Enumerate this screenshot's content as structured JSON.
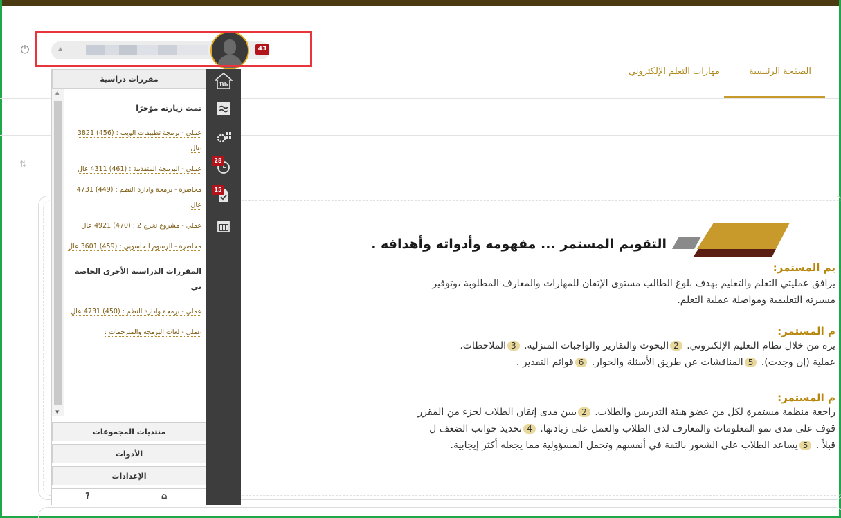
{
  "nav": {
    "home": "الصفحة الرئيسية",
    "skills": "مهارات التعلم الإلكتروني"
  },
  "user": {
    "notification_count": "43"
  },
  "toolbar": {
    "items": [
      {
        "icon": "bb-home-icon"
      },
      {
        "icon": "stream-icon"
      },
      {
        "icon": "grades-icon"
      },
      {
        "icon": "clock-icon",
        "badge": "28"
      },
      {
        "icon": "tasks-icon",
        "badge": "15"
      },
      {
        "icon": "calendar-icon"
      }
    ]
  },
  "drawer": {
    "header": "مقررات دراسية",
    "recent_title": "تمت زيارته مؤخرًا",
    "recent": [
      "عملي - برمجة تطبيقات الويب : (456) 3821 عال",
      "عملي - البرمجة المتقدمة : (461) 4311 عال",
      "محاضرة - برمجة وادارة النظم : (449) 4731 عال",
      "عملي - مشروع تخرج 2 : (470) 4921 عال",
      "محاضرة - الرسوم الحاسوبي : (459) 3601 عال"
    ],
    "other_title": "المقررات الدراسية الأخرى الخاصة بي",
    "other": [
      "عملي - برمجة وادارة النظم : (450) 4731 عال",
      "عملي - لغات البرمجة والمترجمات :"
    ],
    "sections": [
      "منتديات المجموعات",
      "الأدوات",
      "الإعدادات"
    ],
    "footer": {
      "help": "?",
      "home": "⌂"
    }
  },
  "article": {
    "title": "التقويم المستمر ... مفهومه وأدواته وأهدافه .",
    "sec1_head": "يم المستمر:",
    "sec1_lines": [
      "يرافق عمليتي التعلم والتعليم بهدف بلوغ الطالب مستوى الإتقان للمهارات والمعارف المطلوبة ،وتوفير",
      "مسيرته التعليمية ومواصلة عملية التعلم."
    ],
    "sec2_head": "م المستمر:",
    "sec2_line1": [
      "يرة من خلال نظام التعليم الإلكتروني.",
      "2",
      "البحوث والتقارير والواجبات المنزلية.",
      "3",
      "الملاحظات."
    ],
    "sec2_line2": [
      "عملية (إن وجدت).",
      "5",
      "المناقشات عن طريق الأسئلة والحوار.",
      "6",
      "قوائم التقدير ."
    ],
    "sec3_head": "م المستمر:",
    "sec3_line1": [
      "راجعة منظمة مستمرة لكل من عضو هيئة التدريس والطلاب.",
      "2",
      "يبين مدى إتقان الطلاب لجزء من المقرر"
    ],
    "sec3_line2": [
      "قوف على مدى نمو المعلومات والمعارف لدى الطلاب والعمل على زيادتها.",
      "4",
      "تحديد جوانب الضعف ل"
    ],
    "sec3_line3": [
      "قبلاً .",
      "5",
      "يساعد الطلاب على الشعور بالثقة في أنفسهم وتحمل المسؤولية مما يجعله أكثر إيجابية."
    ]
  },
  "colors": {
    "accent": "#c79a2b",
    "badge": "#b3131b",
    "toolbar": "#3d3d3d",
    "frame": "#1fa84a",
    "highlight": "#e8353b"
  }
}
